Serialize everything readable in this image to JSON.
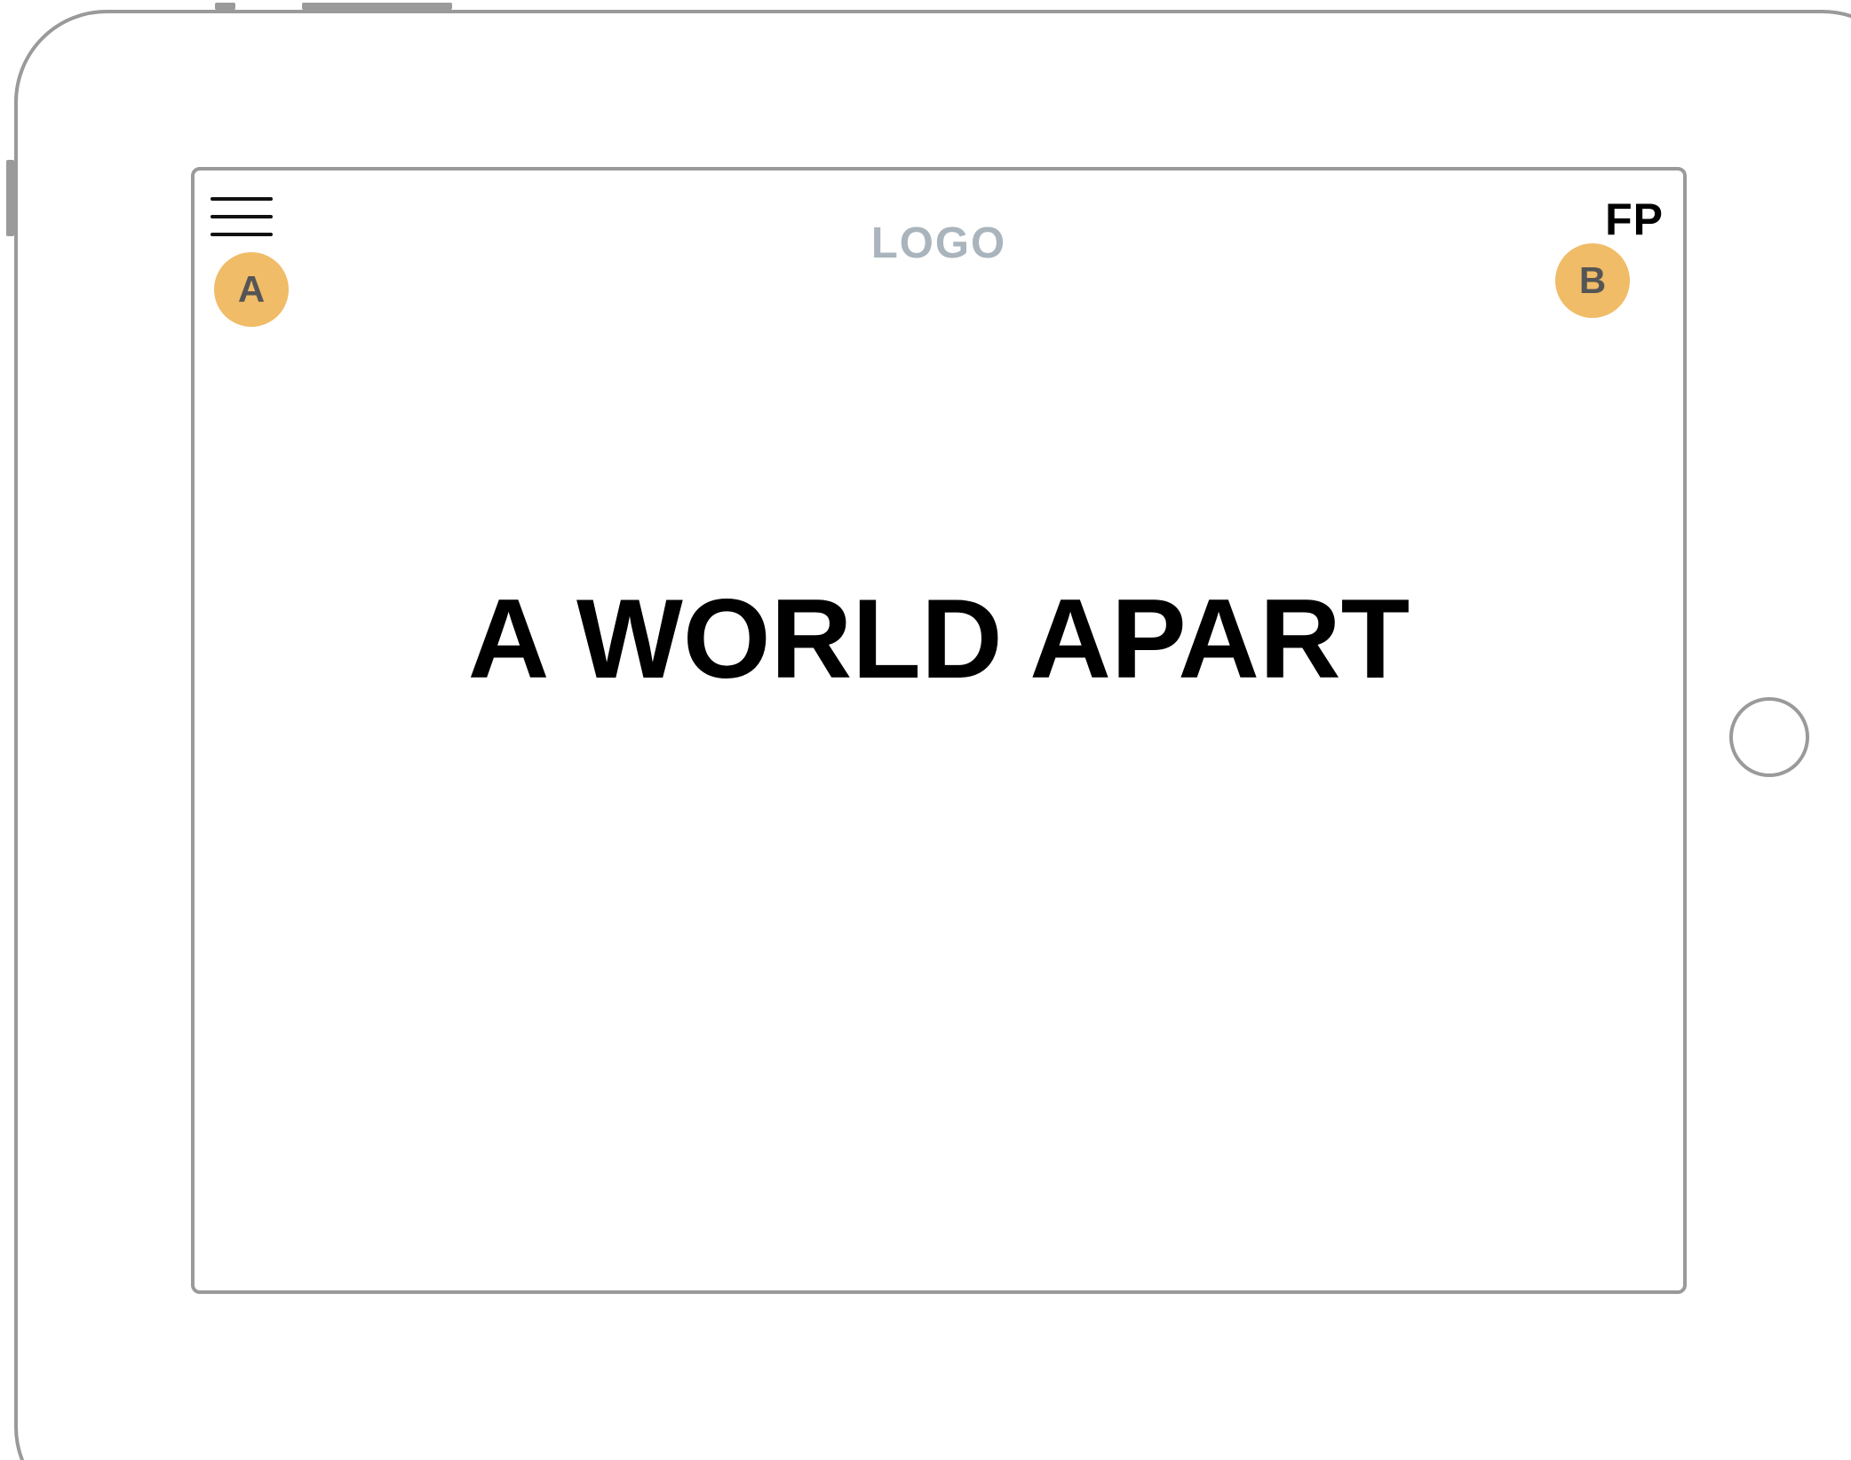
{
  "header": {
    "logo_text": "LOGO",
    "top_right_label": "FP"
  },
  "annotations": {
    "marker_a": "A",
    "marker_b": "B",
    "marker_color": "#f0bc67"
  },
  "hero": {
    "headline": "A WORLD APART"
  },
  "icons": {
    "menu": "hamburger-menu-icon",
    "home": "home-button"
  },
  "colors": {
    "frame": "#9a9a9a",
    "logo": "#a9b4bc",
    "text": "#000000"
  }
}
